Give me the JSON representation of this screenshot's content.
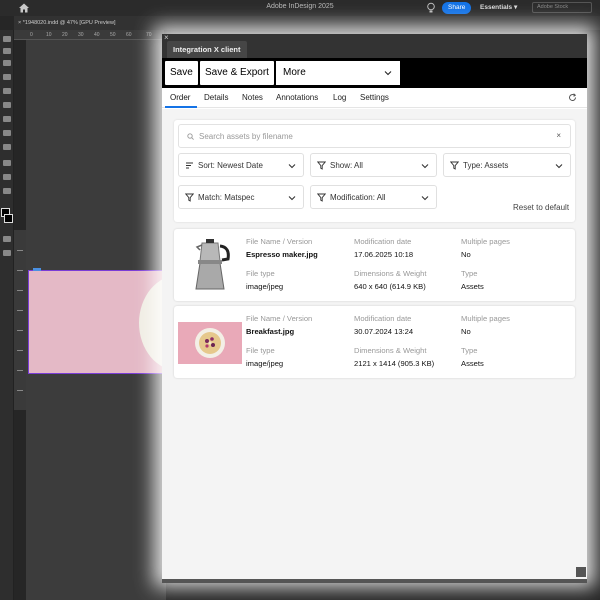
{
  "app": {
    "title": "Adobe InDesign 2025",
    "share": "Share",
    "workspace": "Essentials",
    "stock_search": "Adobe Stock",
    "doc_tab": "*1948020.indd @ 47% [GPU Preview]"
  },
  "ruler": {
    "ticks": [
      "0",
      "10",
      "20",
      "30",
      "40",
      "50",
      "60",
      "70"
    ]
  },
  "panel": {
    "title": "Integration X client",
    "toolbar": {
      "save": "Save",
      "save_export": "Save & Export",
      "more": "More"
    },
    "tabs": [
      "Order",
      "Details",
      "Notes",
      "Annotations",
      "Log",
      "Settings"
    ],
    "active_tab": "Order",
    "search": {
      "placeholder": "Search assets by filename",
      "value": ""
    },
    "filters": {
      "sort": "Sort: Newest Date",
      "show": "Show: All",
      "type": "Type: Assets",
      "match": "Match: Matspec",
      "modification": "Modification: All",
      "reset": "Reset to default"
    },
    "labels": {
      "file_name": "File Name / Version",
      "modification_date": "Modification date",
      "multiple_pages": "Multiple pages",
      "file_type": "File type",
      "dimensions": "Dimensions & Weight",
      "type": "Type"
    },
    "assets": [
      {
        "file_name": "Espresso maker.jpg",
        "modification_date": "17.06.2025 10:18",
        "multiple_pages": "No",
        "file_type": "image/jpeg",
        "dimensions": "640 x 640 (614.9 KB)",
        "type": "Assets"
      },
      {
        "file_name": "Breakfast.jpg",
        "modification_date": "30.07.2024 13:24",
        "multiple_pages": "No",
        "file_type": "image/jpeg",
        "dimensions": "2121 x 1414 (905.3 KB)",
        "type": "Assets"
      }
    ]
  },
  "colors": {
    "accent": "#1473e6",
    "panel_bg": "#f4f4f4",
    "page_pink": "#e4b9c6"
  }
}
